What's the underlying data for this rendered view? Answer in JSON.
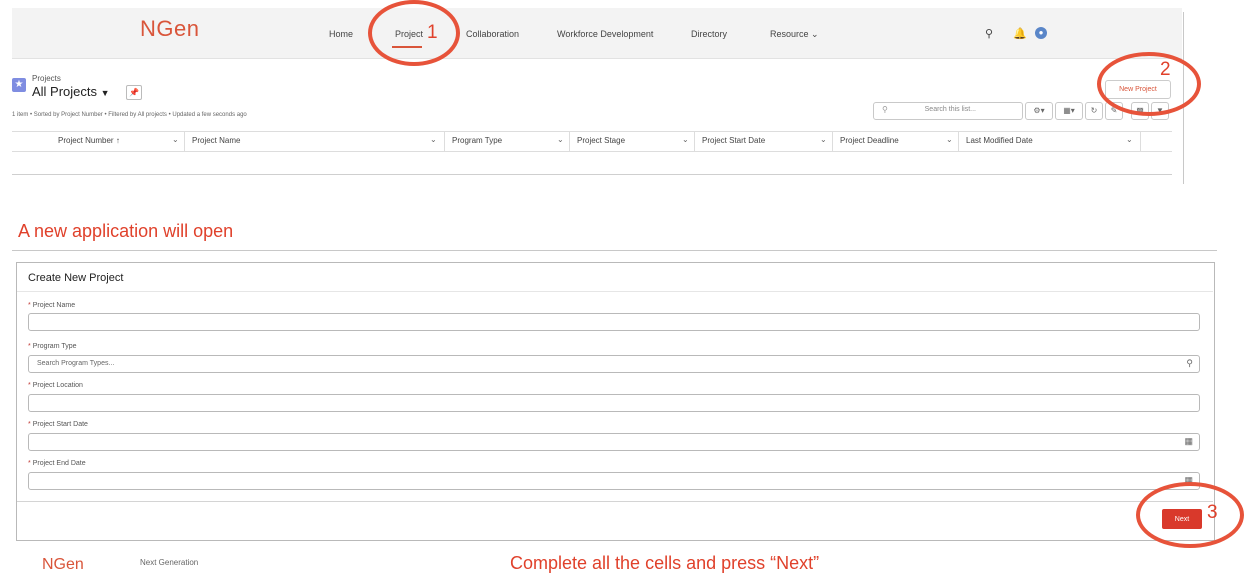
{
  "app": {
    "logo": "NGen"
  },
  "nav": {
    "items": [
      "Home",
      "Project",
      "Collaboration",
      "Workforce Development",
      "Directory",
      "Resource"
    ],
    "icons": [
      "search-icon",
      "bell-icon",
      "user-avatar-icon"
    ]
  },
  "projects": {
    "object_label": "Projects",
    "list_view": "All Projects",
    "meta": "1 item • Sorted by Project Number • Filtered by All projects • Updated a few seconds ago",
    "new_button": "New Project",
    "search_placeholder": "Search this list...",
    "columns": [
      "Project Number",
      "Project Name",
      "Program Type",
      "Project Stage",
      "Project Start Date",
      "Project Deadline",
      "Last Modified Date"
    ]
  },
  "annotations": {
    "step1": "1",
    "step2": "2",
    "step3": "3",
    "caption_open": "A new application will open",
    "caption_complete": "Complete all the cells and press “Next”",
    "accent_color": "#e7533a"
  },
  "form": {
    "title": "Create New Project",
    "fields": [
      {
        "label": "Project Name",
        "placeholder": "",
        "icon": ""
      },
      {
        "label": "Program Type",
        "placeholder": "Search Program Types...",
        "icon": "search-icon"
      },
      {
        "label": "Project Location",
        "placeholder": "",
        "icon": ""
      },
      {
        "label": "Project Start Date",
        "placeholder": "",
        "icon": "calendar-icon"
      },
      {
        "label": "Project End Date",
        "placeholder": "",
        "icon": "calendar-icon"
      }
    ],
    "next_button": "Next",
    "required_mark": "*"
  },
  "footer": {
    "logo": "NGen",
    "tagline": "Next Generation"
  }
}
